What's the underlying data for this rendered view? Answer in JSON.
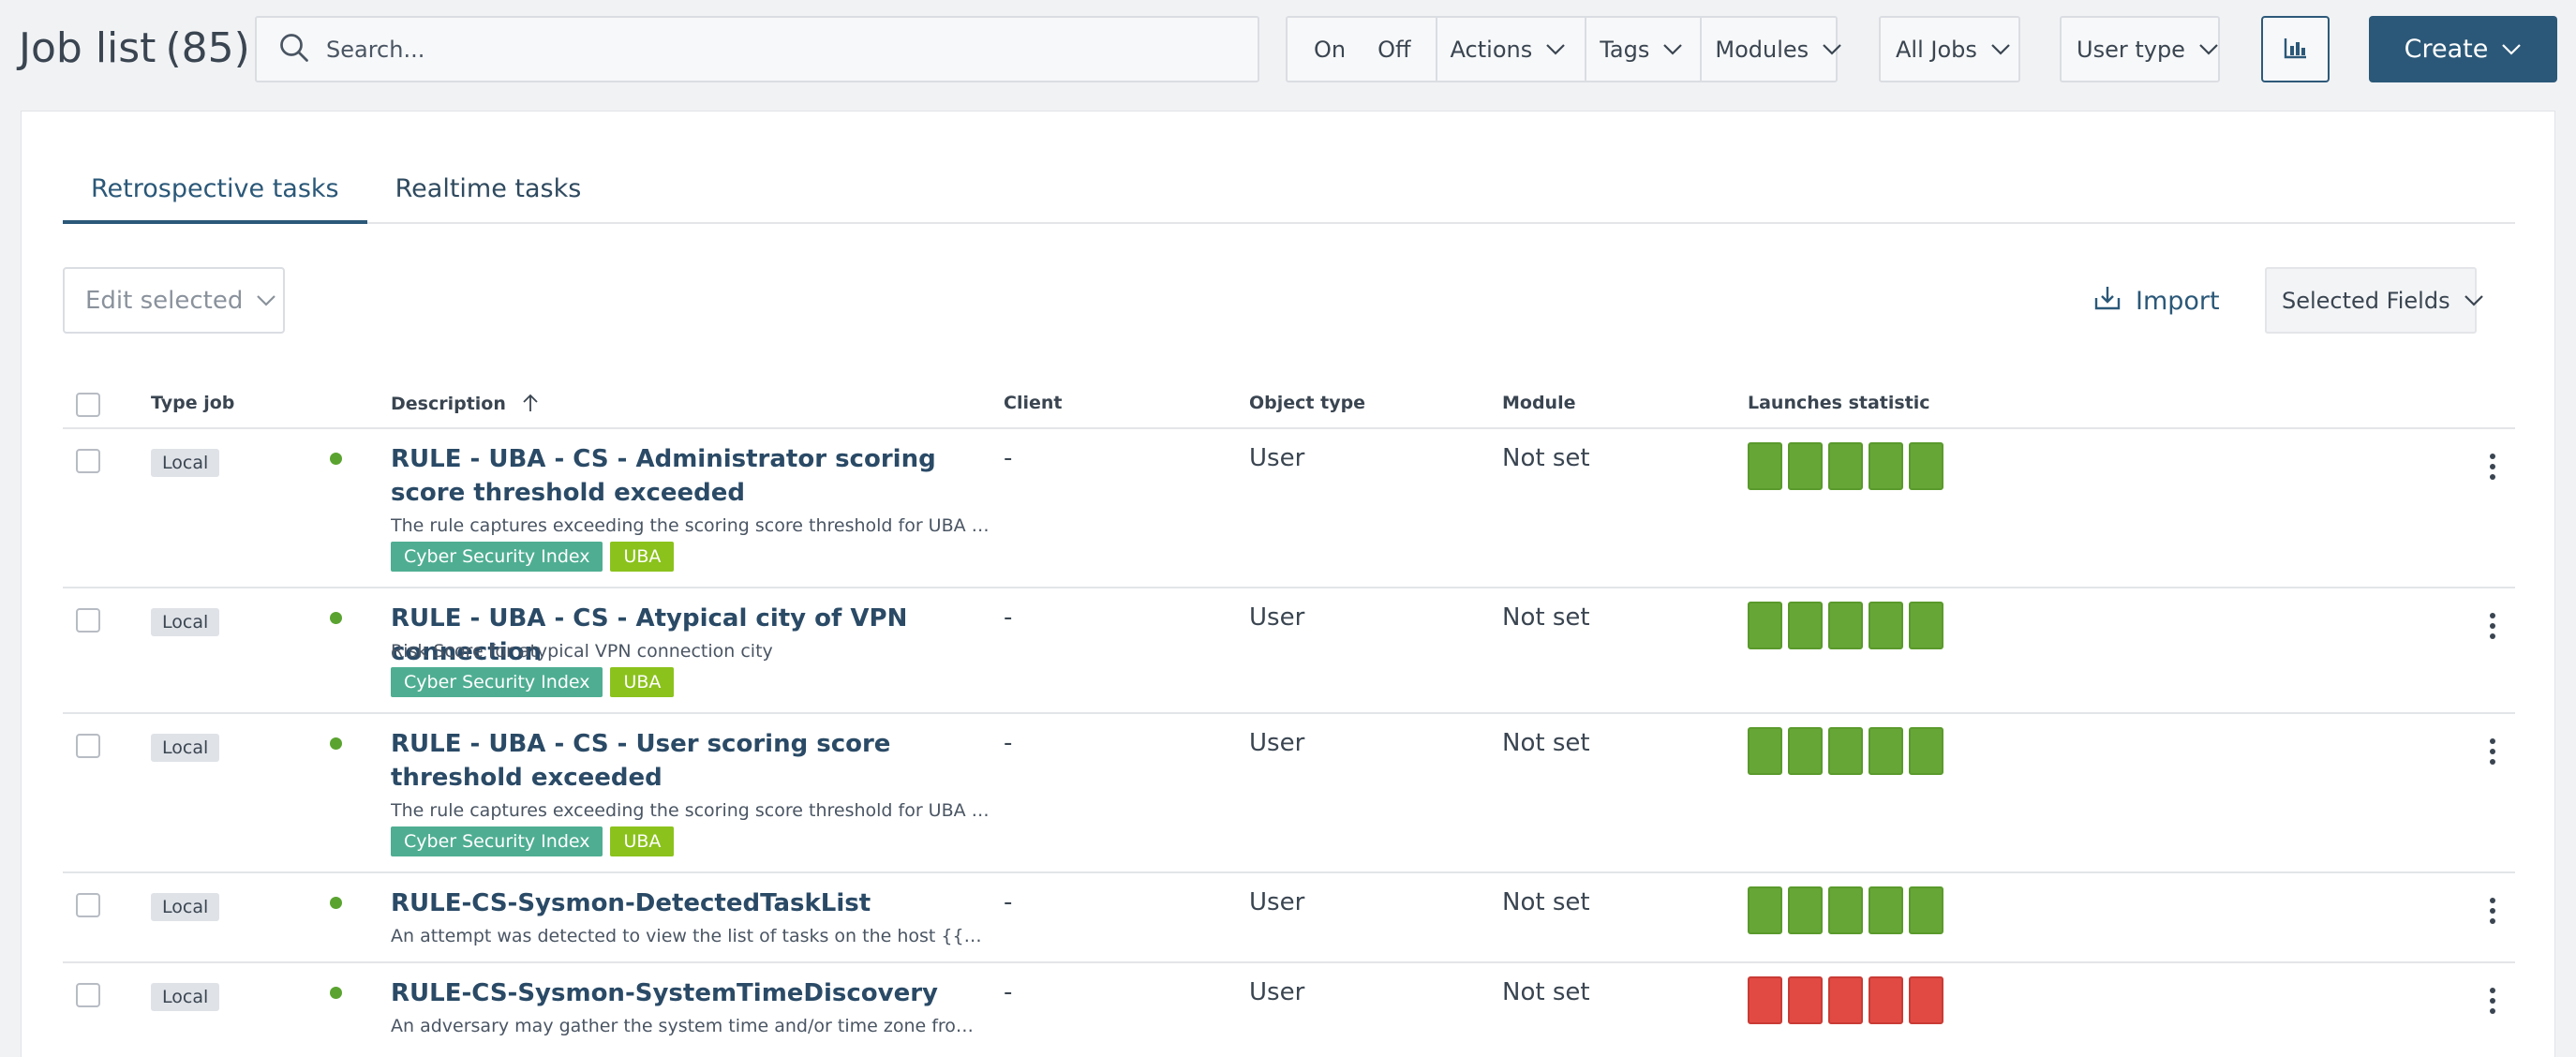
{
  "header": {
    "title": "Job list",
    "count": "(85)",
    "search_placeholder": "Search...",
    "filters": {
      "on": "On",
      "off": "Off",
      "actions": "Actions",
      "tags": "Tags",
      "modules": "Modules",
      "all_jobs": "All Jobs",
      "user_type": "User type"
    },
    "create_label": "Create"
  },
  "tabs": [
    {
      "label": "Retrospective tasks",
      "active": true
    },
    {
      "label": "Realtime tasks",
      "active": false
    }
  ],
  "toolbar": {
    "edit_selected": "Edit selected",
    "import_label": "Import",
    "selected_fields": "Selected Fields"
  },
  "table": {
    "columns": {
      "type_job": "Type job",
      "description": "Description",
      "client": "Client",
      "object_type": "Object type",
      "module": "Module",
      "launches": "Launches statistic"
    },
    "rows": [
      {
        "type": "Local",
        "title": "RULE - UBA - CS - Administrator scoring score threshold exceeded",
        "description": "The rule captures exceeding the scoring score threshold for UBA objec...",
        "tags": [
          "Cyber Security Index",
          "UBA"
        ],
        "client": "-",
        "object_type": "User",
        "module": "Not set",
        "launches": [
          "ok",
          "ok",
          "ok",
          "ok",
          "ok"
        ]
      },
      {
        "type": "Local",
        "title": "RULE - UBA - CS - Atypical city of VPN connection",
        "description": "Risk Score for atypical VPN connection city",
        "tags": [
          "Cyber Security Index",
          "UBA"
        ],
        "client": "-",
        "object_type": "User",
        "module": "Not set",
        "launches": [
          "ok",
          "ok",
          "ok",
          "ok",
          "ok"
        ]
      },
      {
        "type": "Local",
        "title": "RULE - UBA - CS - User scoring score threshold exceeded",
        "description": "The rule captures exceeding the scoring score threshold for UBA objec...",
        "tags": [
          "Cyber Security Index",
          "UBA"
        ],
        "client": "-",
        "object_type": "User",
        "module": "Not set",
        "launches": [
          "ok",
          "ok",
          "ok",
          "ok",
          "ok"
        ]
      },
      {
        "type": "Local",
        "title": "RULE-CS-Sysmon-DetectedTaskList",
        "description": "An attempt was detected to view the list of tasks on the host {{_source...",
        "tags": [],
        "client": "-",
        "object_type": "User",
        "module": "Not set",
        "launches": [
          "ok",
          "ok",
          "ok",
          "ok",
          "ok"
        ]
      },
      {
        "type": "Local",
        "title": "RULE-CS-Sysmon-SystemTimeDiscovery",
        "description": "An adversary may gather the system time and/or time zone from a loc...",
        "tags": [],
        "client": "-",
        "object_type": "User",
        "module": "Not set",
        "launches": [
          "fail",
          "fail",
          "fail",
          "fail",
          "fail"
        ]
      }
    ]
  },
  "colors": {
    "primary": "#2b5878",
    "status_active": "#5aa330",
    "launch_ok": "#66a636",
    "launch_fail": "#e14a43",
    "tag_csi": "#4fae92",
    "tag_uba": "#8bc21c"
  }
}
